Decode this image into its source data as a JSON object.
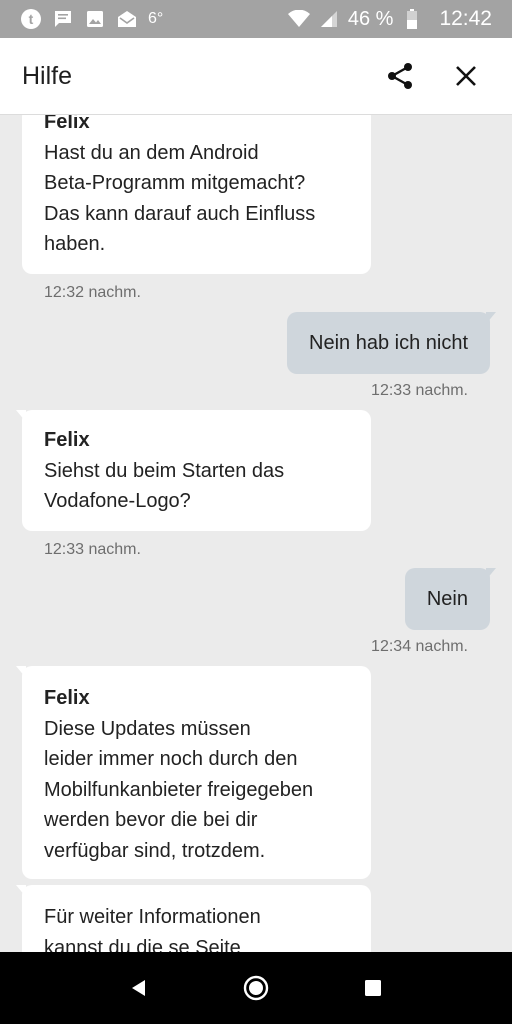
{
  "status_bar": {
    "temperature": "6°",
    "battery_percent": "46 %",
    "time": "12:42",
    "icons": [
      "tumblr-icon",
      "message-icon",
      "image-icon",
      "mail-icon",
      "wifi-icon",
      "signal-icon",
      "battery-icon"
    ]
  },
  "header": {
    "title": "Hilfe",
    "share_icon": "share-icon",
    "close_icon": "close-icon"
  },
  "messages": [
    {
      "direction": "in",
      "sender": "Felix",
      "lines": [
        "Hast du an dem Android",
        "Beta-Programm mitgemacht?",
        "Das kann darauf auch Einfluss",
        "haben."
      ],
      "time": "12:32 nachm."
    },
    {
      "direction": "out",
      "text": "Nein hab ich nicht",
      "time": "12:33 nachm."
    },
    {
      "direction": "in",
      "sender": "Felix",
      "lines": [
        "Siehst du beim Starten das",
        "Vodafone-Logo?"
      ],
      "time": "12:33 nachm."
    },
    {
      "direction": "out",
      "text": "Nein",
      "time": "12:34 nachm."
    },
    {
      "direction": "in",
      "sender": "Felix",
      "lines": [
        "Diese Updates müssen",
        "leider immer noch durch den",
        "Mobilfunkanbieter freigegeben",
        "werden bevor die bei dir",
        "verfügbar sind, trotzdem."
      ]
    },
    {
      "direction": "in",
      "lines": [
        "Für weiter Informationen",
        "kannst du die se Seite"
      ]
    }
  ],
  "nav": {
    "back": "back-icon",
    "home": "home-icon",
    "recents": "recents-icon"
  },
  "colors": {
    "outgoing_bubble": "#cfd6dc",
    "incoming_bubble": "#ffffff",
    "background": "#ebebeb",
    "status_bar": "#a3a3a3"
  }
}
